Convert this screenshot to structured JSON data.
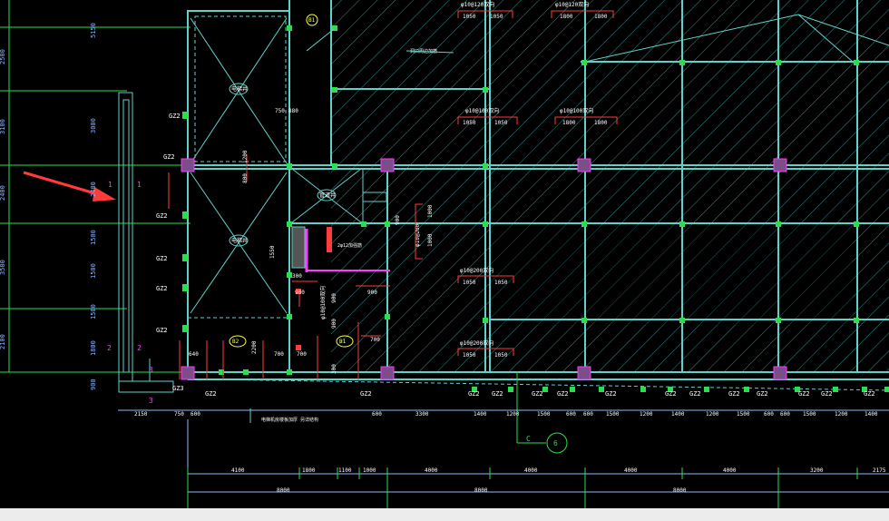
{
  "colors": {
    "background": "#000000",
    "wall": "#5ed1c8",
    "hatch": "#3fa7a2",
    "dimension": "#8fb8ff",
    "label_red": "#ff3b3b",
    "label_white": "#ffffff",
    "label_magenta": "#ff39ff",
    "label_yellow": "#ffff3c",
    "green": "#27e04b",
    "column_fill": "#7b4e89",
    "bottom_bar": "#ececec"
  },
  "left_dimensions": {
    "outer": [
      "2500",
      "3100",
      "2400",
      "3500",
      "2100"
    ],
    "inner": [
      "5150",
      "3000",
      "2400",
      "1500",
      "1500",
      "1500",
      "1800",
      "900"
    ]
  },
  "shaft_labels": {
    "one": "1",
    "two": "2",
    "three": "3"
  },
  "column_tags": {
    "gz1": "GZ1",
    "gz2": "GZ2",
    "gz3": "GZ3"
  },
  "bottom_dims_row1": [
    "2150",
    "750",
    "600",
    "600",
    "3300",
    "1400",
    "1200",
    "1500",
    "600",
    "600",
    "1500",
    "1200",
    "1400",
    "1200",
    "1500",
    "600",
    "600",
    "1500",
    "1200",
    "1400"
  ],
  "bottom_dims_row2": [
    "4100",
    "1800",
    "1100",
    "1000",
    "4000",
    "4000",
    "4000",
    "4000",
    "3200",
    "2175"
  ],
  "bottom_dims_row3": [
    "8000",
    "8000",
    "8000"
  ],
  "grid_bubbles": {
    "c": "C",
    "six": "6"
  },
  "slab_tags": {
    "top_a": "φ10@120双向",
    "top_b": "φ10@120双向",
    "mid_a": "φ10@100双向",
    "mid_b": "φ10@100双向",
    "low_a": "φ10@200双向",
    "low_b": "φ10@200双向",
    "side": "φ10@200",
    "stair": "φ10@100双向"
  },
  "slab_numbers": {
    "n1050": "1050",
    "n1800": "1800",
    "n900": "900",
    "n700": "700",
    "n1550": "1550",
    "n700b": "700",
    "n1000": "1000",
    "n640": "640",
    "n2200": "2200",
    "n300": "300",
    "n1200": "1200",
    "n750": "750",
    "n880": "880",
    "n800": "800"
  },
  "room_tags": {
    "elev": "电梯井",
    "pipe": "管道井",
    "b1": "B1",
    "b2": "B2"
  },
  "notes": {
    "floor": "电梯机房楼板加厚\n另详结构",
    "beam": "2φ12加强筋",
    "opening": "洞口周边加筋"
  }
}
